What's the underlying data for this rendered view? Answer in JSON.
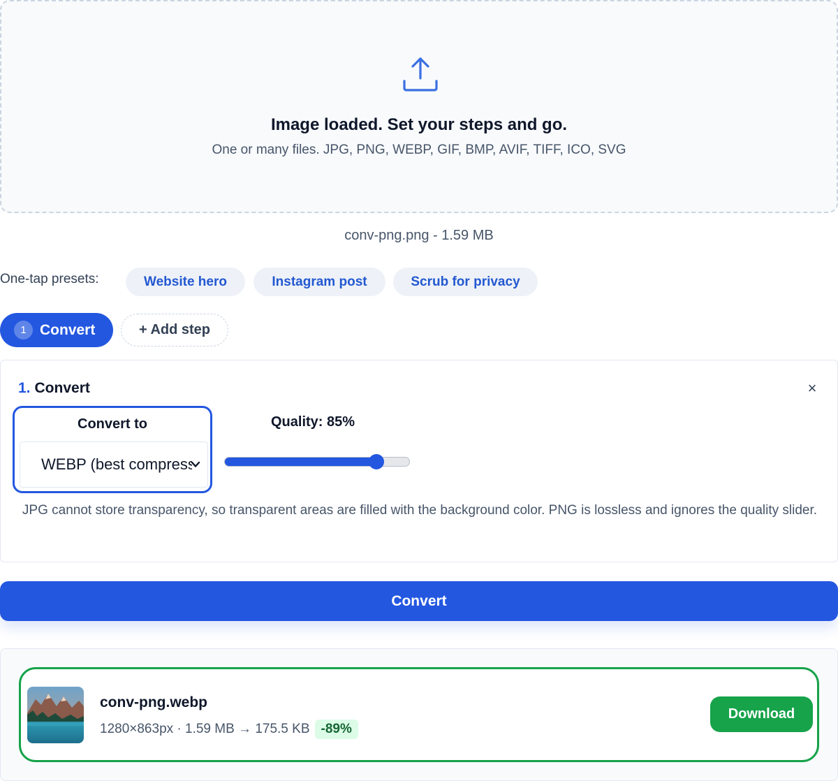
{
  "dropzone": {
    "title": "Image loaded. Set your steps and go.",
    "subtitle": "One or many files. JPG, PNG, WEBP, GIF, BMP, AVIF, TIFF, ICO, SVG",
    "icon": "upload-icon"
  },
  "file_info": "conv-png.png - 1.59 MB",
  "presets": {
    "label": "One-tap presets:",
    "items": [
      "Website hero",
      "Instagram post",
      "Scrub for privacy"
    ]
  },
  "steps": {
    "active_number": "1",
    "active_label": "Convert",
    "add_label": "+ Add step"
  },
  "step_card": {
    "number": "1.",
    "title": "Convert",
    "close_symbol": "×",
    "convert_to_label": "Convert to",
    "format_value": "WEBP (best compression)",
    "quality_label": "Quality: 85%",
    "quality_value": 85,
    "note": "JPG cannot store transparency, so transparent areas are filled with the background color. PNG is lossless and ignores the quality slider."
  },
  "convert_button": "Convert",
  "result": {
    "filename": "conv-png.webp",
    "meta": "1280×863px · 1.59 MB → 175.5 KB",
    "savings": "-89%",
    "download_label": "Download"
  },
  "colors": {
    "accent": "#2357e0",
    "success": "#16a34a",
    "chip_bg": "#eef2f8",
    "badge_bg": "#dcfce7"
  }
}
